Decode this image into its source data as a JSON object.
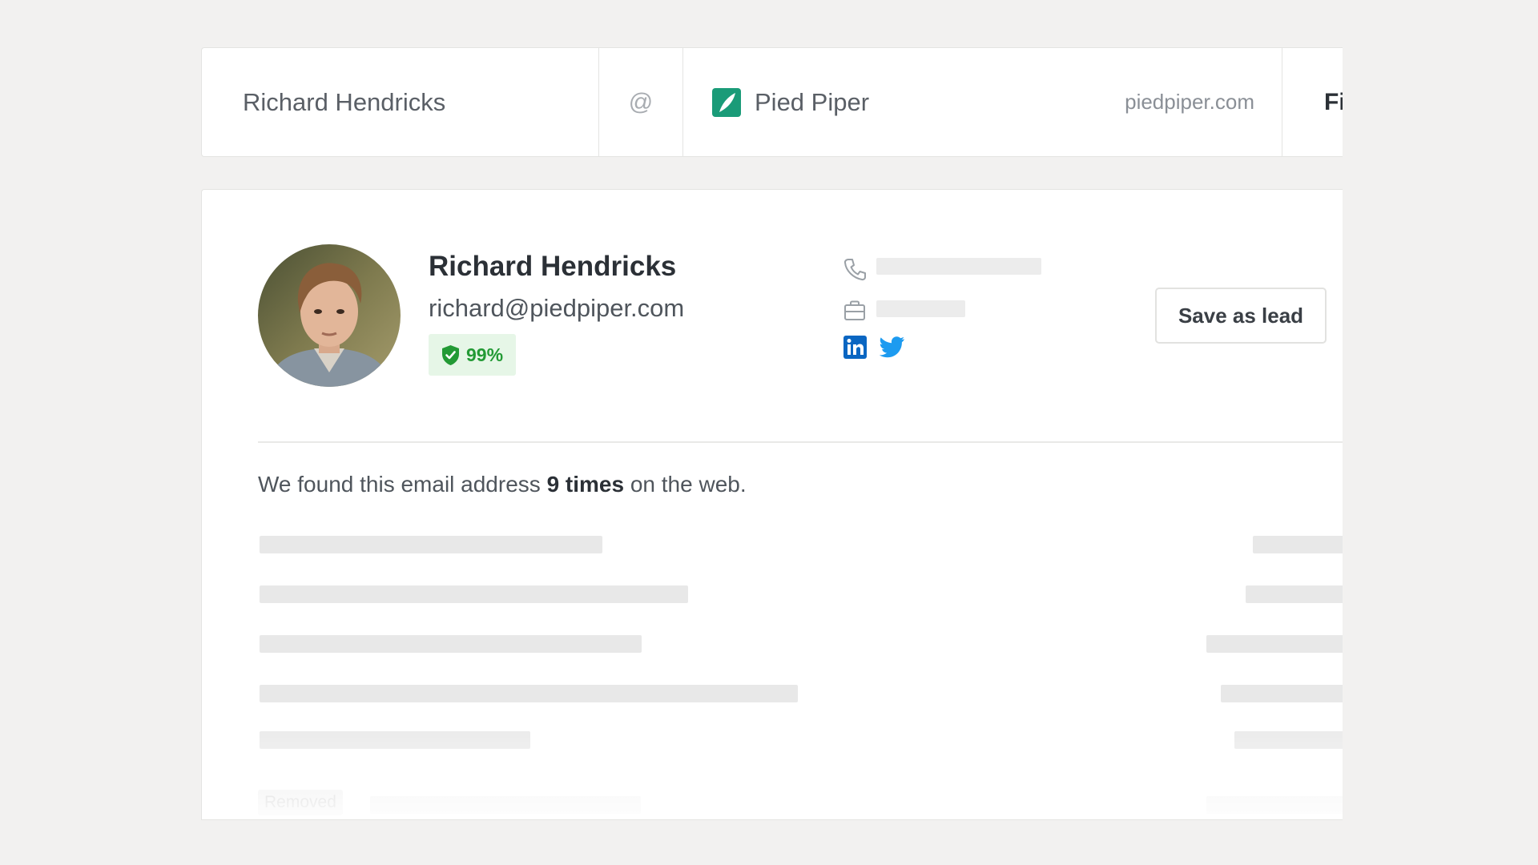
{
  "search": {
    "name_value": "Richard Hendricks",
    "at_symbol": "@",
    "company_name": "Pied Piper",
    "company_domain": "piedpiper.com",
    "find_label": "Fi"
  },
  "result": {
    "name": "Richard Hendricks",
    "email": "richard@piedpiper.com",
    "confidence": "99%",
    "save_label": "Save as lead",
    "found_prefix": "We found this email address ",
    "found_count": "9 times",
    "found_suffix": " on the web.",
    "removed_label": "Removed"
  },
  "icons": {
    "company_logo": "pied-piper-logo",
    "phone": "phone-icon",
    "briefcase": "briefcase-icon",
    "linkedin": "linkedin-icon",
    "twitter": "twitter-icon",
    "shield": "shield-check-icon"
  },
  "colors": {
    "logo_green": "#1a9b78",
    "linkedin_blue": "#0a66c2",
    "twitter_blue": "#1d9bf0",
    "score_green": "#239a35",
    "score_bg": "#e6f6e7"
  }
}
